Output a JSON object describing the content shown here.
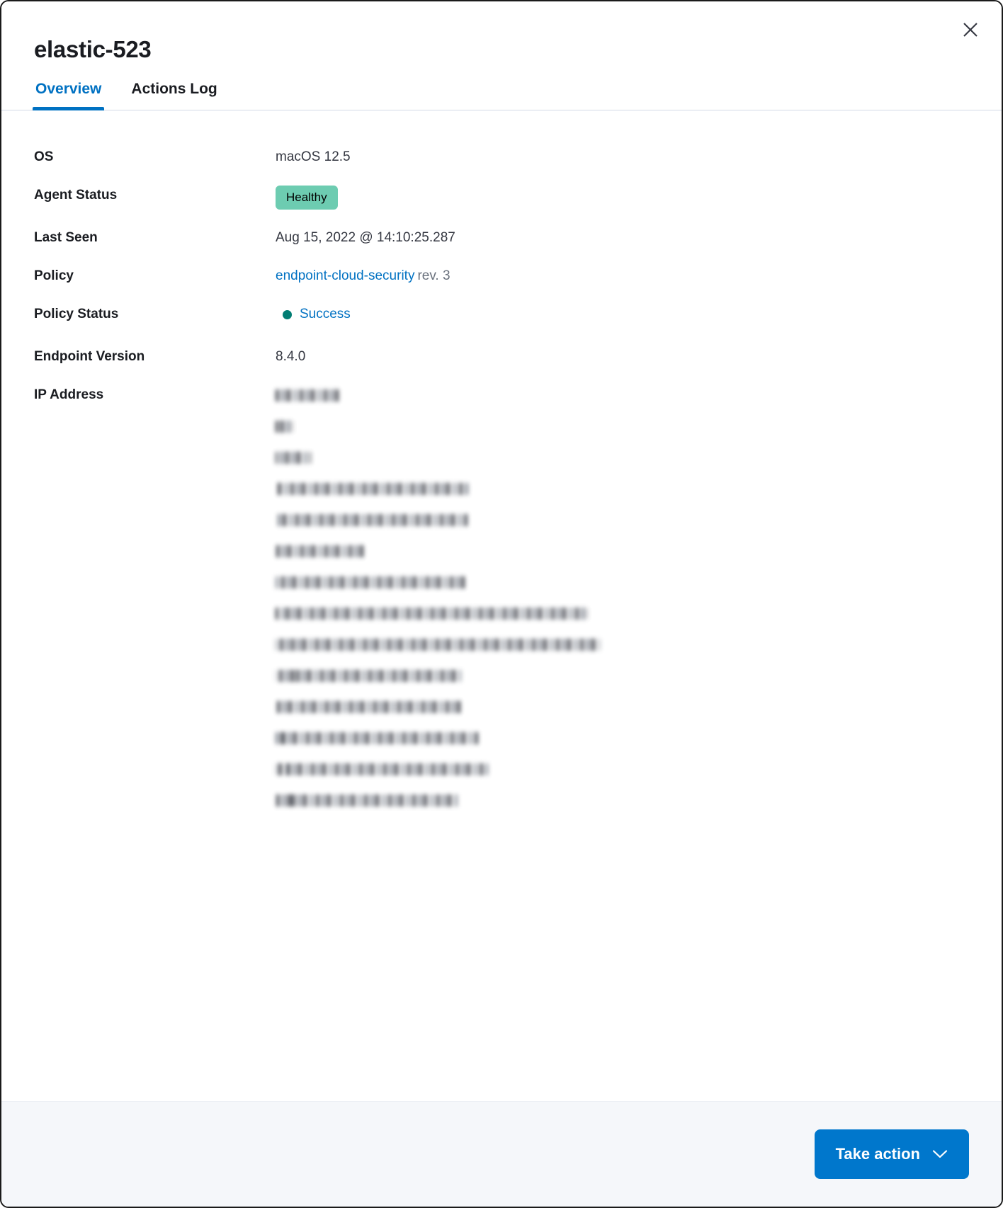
{
  "panel": {
    "title": "elastic-523",
    "close_icon": "close-icon"
  },
  "tabs": [
    {
      "label": "Overview",
      "active": true
    },
    {
      "label": "Actions Log",
      "active": false
    }
  ],
  "details": {
    "os": {
      "label": "OS",
      "value": "macOS 12.5"
    },
    "agent_status": {
      "label": "Agent Status",
      "value": "Healthy",
      "badge_color": "#6dccb1"
    },
    "last_seen": {
      "label": "Last Seen",
      "value": "Aug 15, 2022 @ 14:10:25.287"
    },
    "policy": {
      "label": "Policy",
      "value": "endpoint-cloud-security",
      "revision": "rev. 3",
      "link_color": "#0071c2"
    },
    "policy_status": {
      "label": "Policy Status",
      "value": "Success",
      "dot_color": "#017d73",
      "text_color": "#0071c2"
    },
    "endpoint_version": {
      "label": "Endpoint Version",
      "value": "8.4.0"
    },
    "ip_address": {
      "label": "IP Address",
      "redacted": true,
      "values": [
        {
          "redacted_width": 90
        },
        {
          "redacted_width": 24
        },
        {
          "redacted_width": 50
        },
        {
          "redacted_width": 272
        },
        {
          "redacted_width": 272
        },
        {
          "redacted_width": 128
        },
        {
          "redacted_width": 272
        },
        {
          "redacted_width": 440
        },
        {
          "redacted_width": 458
        },
        {
          "redacted_width": 262
        },
        {
          "redacted_width": 264
        },
        {
          "redacted_width": 290
        },
        {
          "redacted_width": 300
        },
        {
          "redacted_width": 260
        }
      ]
    }
  },
  "footer": {
    "take_action_label": "Take action",
    "chevron_icon": "chevron-down-icon",
    "button_color": "#0077cc"
  }
}
